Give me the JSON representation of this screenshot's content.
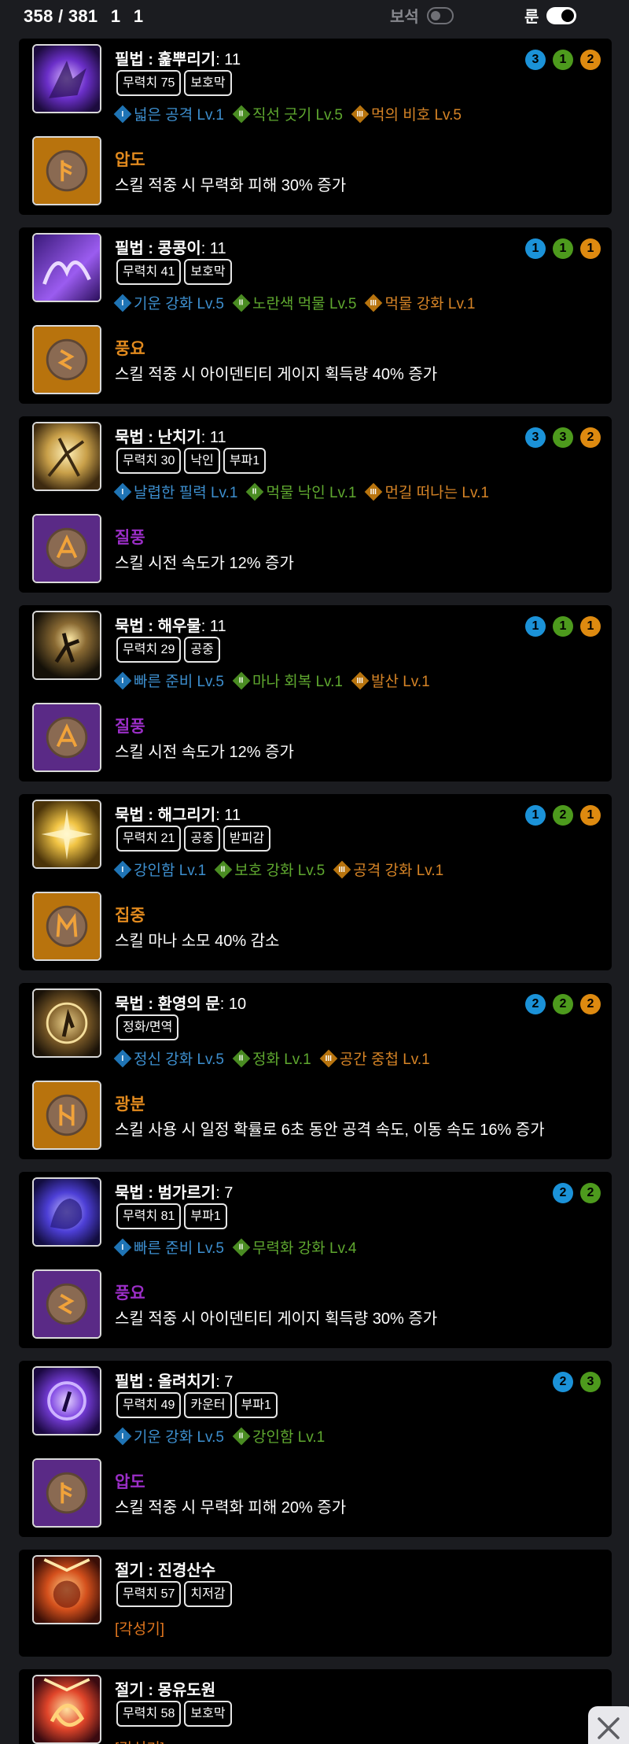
{
  "header": {
    "count": "358 / 381",
    "val_a": "1",
    "val_b": "1",
    "gem_toggle_label": "보석",
    "rune_toggle_label": "룬"
  },
  "cards": [
    {
      "name": "필법 : 훑뿌리기",
      "level": ": 11",
      "tags": [
        "무력치 75",
        "보호막"
      ],
      "tripods": [
        "넓은 공격 Lv.1",
        "직선 긋기 Lv.5",
        "먹의 비호 Lv.5"
      ],
      "rune_name": "압도",
      "rune_color": "#e28a1e",
      "rune_desc": "스킬 적중 시 무력화 피해 30% 증가",
      "gems": [
        "3",
        "1",
        "2"
      ]
    },
    {
      "name": "필법 : 콩콩이",
      "level": ": 11",
      "tags": [
        "무력치 41",
        "보호막"
      ],
      "tripods": [
        "기운 강화 Lv.5",
        "노란색 먹물 Lv.5",
        "먹물 강화 Lv.1"
      ],
      "rune_name": "풍요",
      "rune_color": "#e28a1e",
      "rune_desc": "스킬 적중 시 아이덴티티 게이지 획득량 40% 증가",
      "gems": [
        "1",
        "1",
        "1"
      ]
    },
    {
      "name": "묵법 : 난치기",
      "level": ": 11",
      "tags": [
        "무력치 30",
        "낙인",
        "부파1"
      ],
      "tripods": [
        "날렵한 필력 Lv.1",
        "먹물 낙인 Lv.1",
        "먼길 떠나는 Lv.1"
      ],
      "rune_name": "질풍",
      "rune_color": "#9b2ec7",
      "rune_desc": "스킬 시전 속도가 12% 증가",
      "gems": [
        "3",
        "3",
        "2"
      ]
    },
    {
      "name": "묵법 : 해우물",
      "level": ": 11",
      "tags": [
        "무력치 29",
        "공중"
      ],
      "tripods": [
        "빠른 준비 Lv.5",
        "마나 회복 Lv.1",
        "발산 Lv.1"
      ],
      "rune_name": "질풍",
      "rune_color": "#9b2ec7",
      "rune_desc": "스킬 시전 속도가 12% 증가",
      "gems": [
        "1",
        "1",
        "1"
      ]
    },
    {
      "name": "묵법 : 해그리기",
      "level": ": 11",
      "tags": [
        "무력치 21",
        "공중",
        "받피감"
      ],
      "tripods": [
        "강인함 Lv.1",
        "보호 강화 Lv.5",
        "공격 강화 Lv.1"
      ],
      "rune_name": "집중",
      "rune_color": "#e28a1e",
      "rune_desc": "스킬 마나 소모 40% 감소",
      "gems": [
        "1",
        "2",
        "1"
      ]
    },
    {
      "name": "묵법 : 환영의 문",
      "level": ": 10",
      "tags": [
        "정화/면역"
      ],
      "tripods": [
        "정신 강화 Lv.5",
        "정화 Lv.1",
        "공간 중첩 Lv.1"
      ],
      "rune_name": "광분",
      "rune_color": "#e28a1e",
      "rune_desc": "스킬 사용 시 일정 확률로 6초 동안 공격 속도, 이동 속도 16% 증가",
      "gems": [
        "2",
        "2",
        "2"
      ]
    },
    {
      "name": "묵법 : 범가르기",
      "level": ": 7",
      "tags": [
        "무력치 81",
        "부파1"
      ],
      "tripods": [
        "빠른 준비 Lv.5",
        "무력화 강화 Lv.4"
      ],
      "rune_name": "풍요",
      "rune_color": "#9b2ec7",
      "rune_desc": "스킬 적중 시 아이덴티티 게이지 획득량 30% 증가",
      "gems": [
        "2",
        "2"
      ]
    },
    {
      "name": "필법 : 올려치기",
      "level": ": 7",
      "tags": [
        "무력치 49",
        "카운터",
        "부파1"
      ],
      "tripods": [
        "기운 강화 Lv.5",
        "강인함 Lv.1"
      ],
      "rune_name": "압도",
      "rune_color": "#9b2ec7",
      "rune_desc": "스킬 적중 시 무력화 피해 20% 증가",
      "gems": [
        "2",
        "3"
      ]
    },
    {
      "name": "절기 : 진경산수",
      "level": "",
      "tags": [
        "무력치 57",
        "치저감"
      ],
      "awaken": "[각성기]"
    },
    {
      "name": "절기 : 몽유도원",
      "level": "",
      "tags": [
        "무력치 58",
        "보호막"
      ],
      "awaken": "[각성기]"
    }
  ],
  "colors": {
    "background": "#1b1c20",
    "card": "#000000",
    "tripod1": "#3d8fcf",
    "tripod2": "#5fa82f",
    "tripod3": "#d68426",
    "legendary_rune": "#e28a1e",
    "epic_rune": "#9b2ec7"
  },
  "icons": {
    "close": "close-icon",
    "roman_numerals": [
      "I",
      "II",
      "III"
    ]
  }
}
